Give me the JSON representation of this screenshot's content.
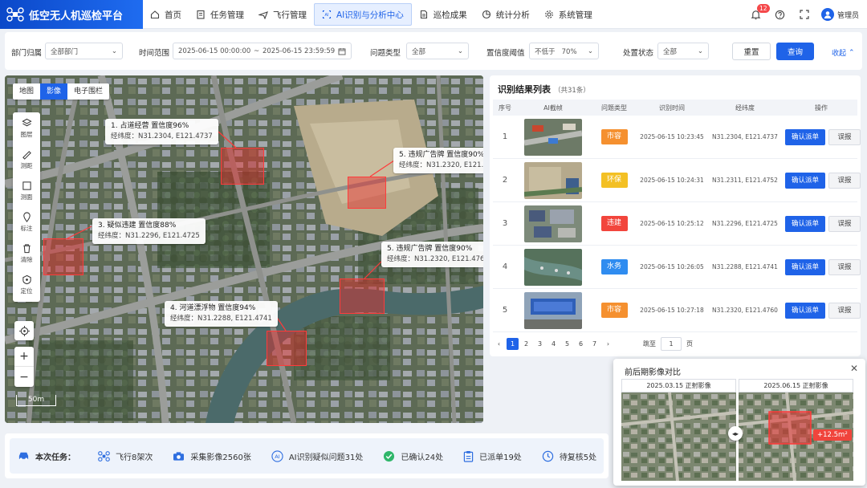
{
  "header": {
    "app_title": "低空无人机巡检平台",
    "nav": [
      {
        "label": "首页",
        "icon": "home-icon"
      },
      {
        "label": "任务管理",
        "icon": "task-icon"
      },
      {
        "label": "飞行管理",
        "icon": "plane-icon"
      },
      {
        "label": "AI识别与分析中心",
        "icon": "ai-icon",
        "active": true
      },
      {
        "label": "巡检成果",
        "icon": "document-icon"
      },
      {
        "label": "统计分析",
        "icon": "pie-chart-icon"
      },
      {
        "label": "系统管理",
        "icon": "gear-icon"
      }
    ],
    "notification_count": "12",
    "user_name": "管理员"
  },
  "filter": {
    "department_label": "部门归属",
    "department_value": "全部部门",
    "time_label": "时间范围",
    "time_start": "2025-06-15 00:00:00",
    "time_sep": "~",
    "time_end": "2025-06-15 23:59:59",
    "issue_type_label": "问题类型",
    "issue_type_value": "全部",
    "confidence_label": "置信度阈值",
    "confidence_prefix": "不低于",
    "confidence_value": "70%",
    "status_label": "处置状态",
    "status_value": "全部",
    "reset_label": "重置",
    "query_label": "查询",
    "collapse_label": "收起"
  },
  "map": {
    "tabs": [
      "地图",
      "影像",
      "电子围栏"
    ],
    "active_tab": "影像",
    "tools": [
      "图层",
      "测距",
      "测面",
      "标注",
      "清除",
      "定位"
    ],
    "scale": "50m",
    "callouts": [
      {
        "title": "1. 占道经营   置信度96%",
        "coords": "经纬度：N31.2304, E121.4737"
      },
      {
        "title": "3. 疑似违建   置信度88%",
        "coords": "经纬度：N31.2296, E121.4725"
      },
      {
        "title": "4. 河道漂浮物  置信度94%",
        "coords": "经纬度：N31.2288, E121.4741"
      },
      {
        "title": "5. 违规广告牌  置信度90%",
        "coords": "经纬度：N31.2320, E121.4760"
      },
      {
        "title": "5. 违规广告牌  置信度90%",
        "coords": "经纬度：N31.2320, E121.4760"
      }
    ]
  },
  "results": {
    "title": "识别结果列表",
    "count": "（共31条）",
    "columns": [
      "序号",
      "AI截帧",
      "问题类型",
      "识别时间",
      "经纬度",
      "操作"
    ],
    "rows": [
      {
        "no": "1",
        "type": "市容",
        "color": "#f5902f",
        "time": "2025-06-15 10:23:45",
        "coords": "N31.2304, E121.4737"
      },
      {
        "no": "2",
        "type": "环保",
        "color": "#f3c024",
        "time": "2025-06-15 10:24:31",
        "coords": "N31.2311, E121.4752"
      },
      {
        "no": "3",
        "type": "违建",
        "color": "#f2453c",
        "time": "2025-06-15 10:25:12",
        "coords": "N31.2296, E121.4725"
      },
      {
        "no": "4",
        "type": "水务",
        "color": "#2f8cf0",
        "time": "2025-06-15 10:26:05",
        "coords": "N31.2288, E121.4741"
      },
      {
        "no": "5",
        "type": "市容",
        "color": "#f5902f",
        "time": "2025-06-15 10:27:18",
        "coords": "N31.2320, E121.4760"
      }
    ],
    "confirm_label": "确认派单",
    "misreport_label": "误报",
    "pages": [
      "1",
      "2",
      "3",
      "4",
      "5",
      "6",
      "7"
    ],
    "goto_label": "跳至",
    "goto_value": "1",
    "page_unit": "页"
  },
  "compare": {
    "title": "前后期影像对比",
    "before_label": "2025.03.15 正射影像",
    "after_label": "2025.06.15 正射影像",
    "change": "+12.5m²"
  },
  "summary": {
    "label": "本次任务：",
    "stats": [
      {
        "text": "飞行8架次",
        "icon": "drone-icon"
      },
      {
        "text": "采集影像2560张",
        "icon": "camera-icon"
      },
      {
        "text": "AI识别疑似问题31处",
        "icon": "ai-icon"
      },
      {
        "text": "已确认24处",
        "icon": "check-icon"
      },
      {
        "text": "已派单19处",
        "icon": "clipboard-icon"
      },
      {
        "text": "待复核5处",
        "icon": "clock-icon"
      }
    ]
  }
}
